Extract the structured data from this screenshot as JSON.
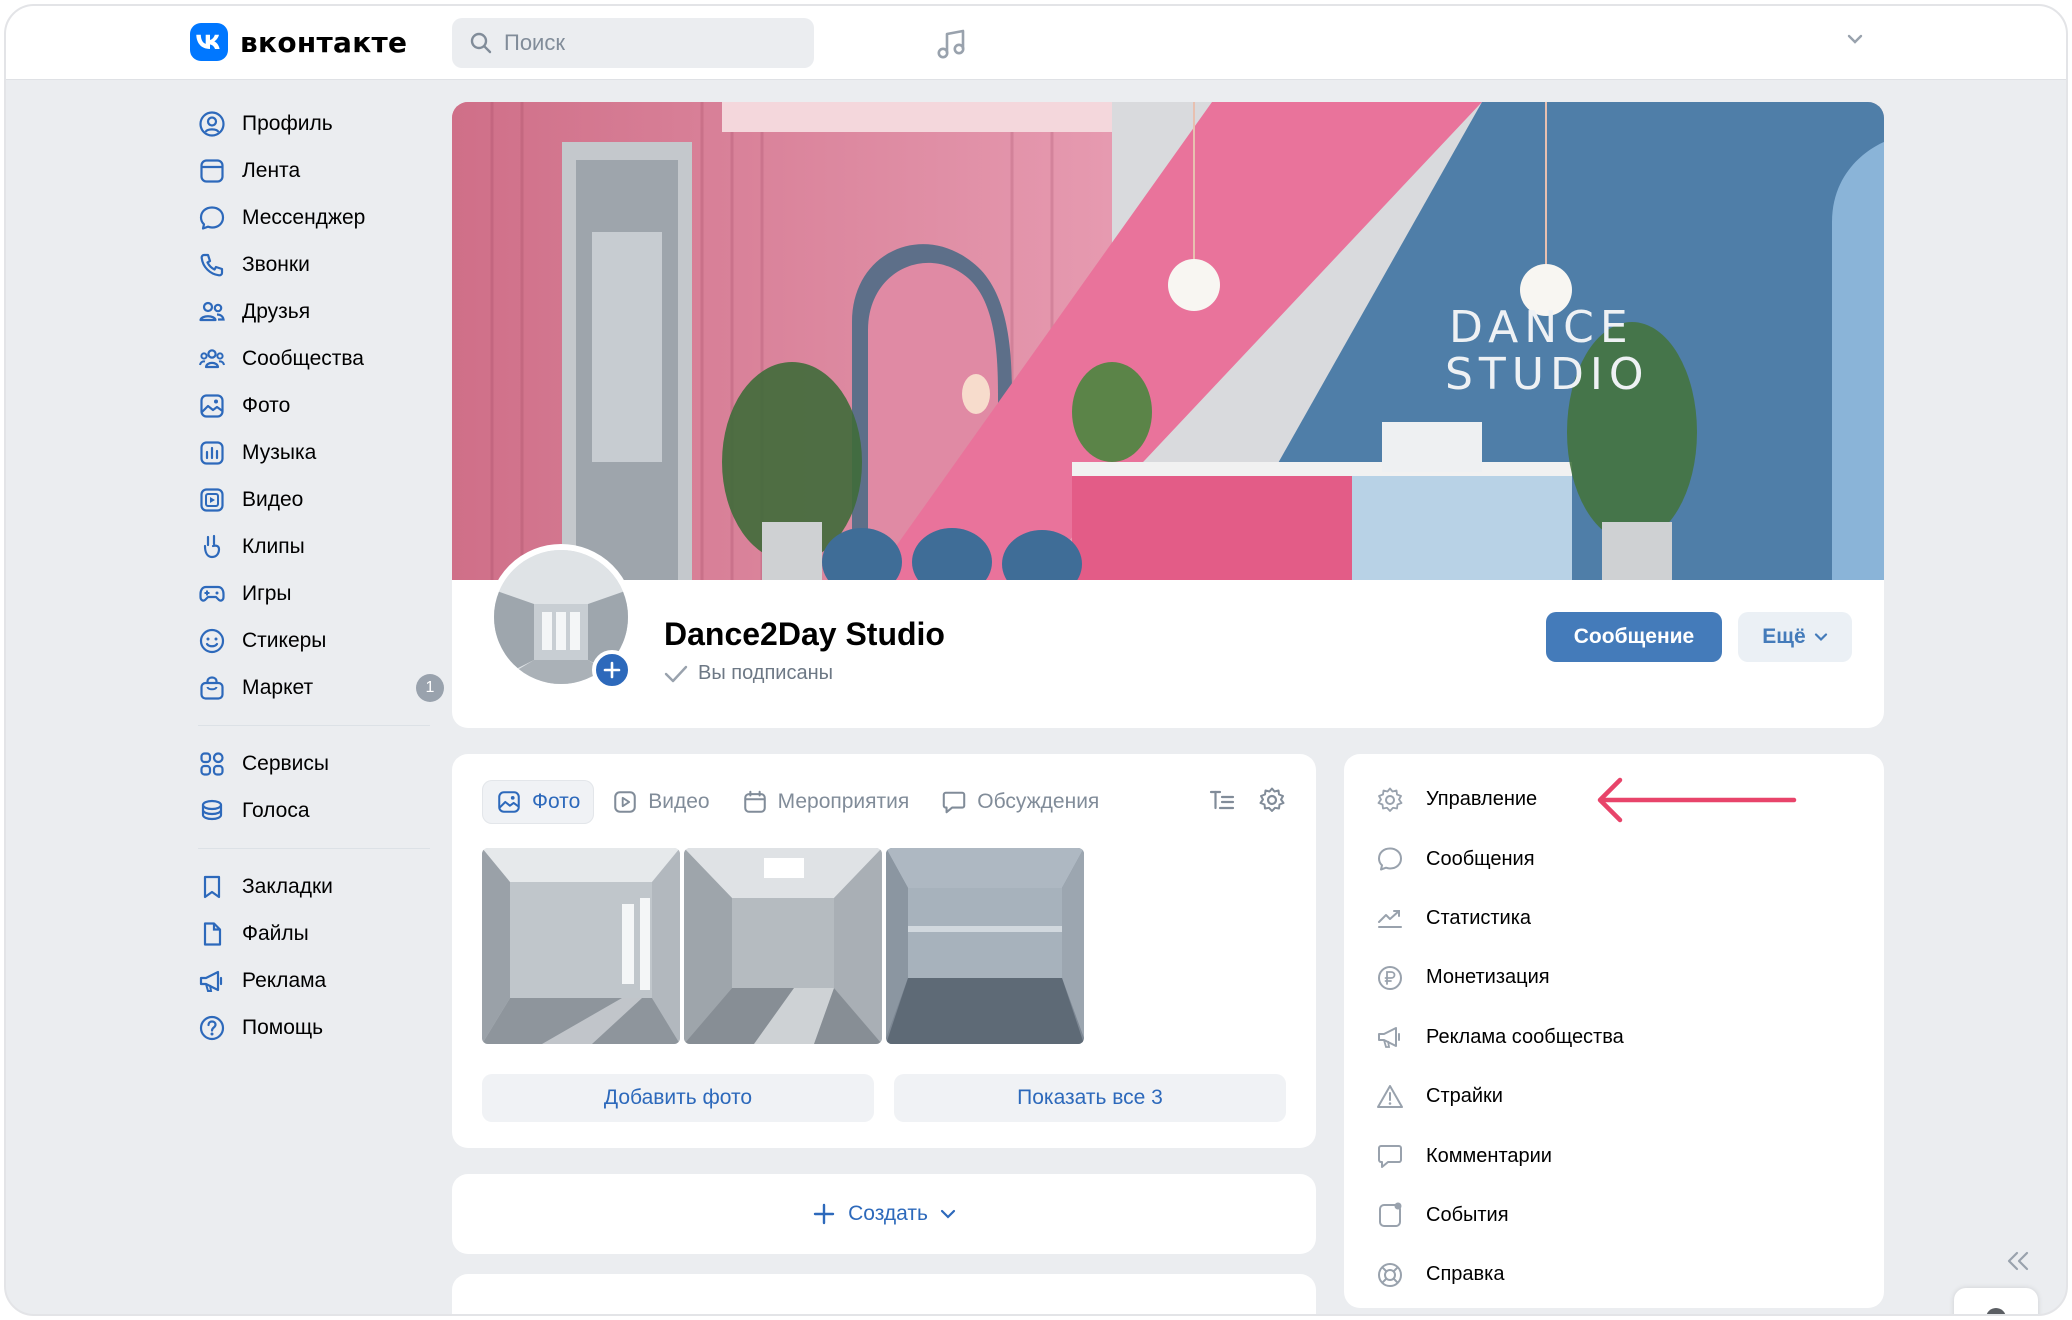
{
  "header": {
    "logo_text": "вконтакте",
    "search_placeholder": "Поиск",
    "icons": [
      "vk-logo-icon",
      "search-icon",
      "music-note-icon",
      "chevron-down-icon"
    ]
  },
  "sidebar": {
    "items": [
      {
        "label": "Профиль",
        "icon": "profile-icon"
      },
      {
        "label": "Лента",
        "icon": "feed-icon"
      },
      {
        "label": "Мессенджер",
        "icon": "messenger-icon"
      },
      {
        "label": "Звонки",
        "icon": "phone-icon"
      },
      {
        "label": "Друзья",
        "icon": "friends-icon"
      },
      {
        "label": "Сообщества",
        "icon": "communities-icon"
      },
      {
        "label": "Фото",
        "icon": "photo-icon"
      },
      {
        "label": "Музыка",
        "icon": "music-icon"
      },
      {
        "label": "Видео",
        "icon": "video-icon"
      },
      {
        "label": "Клипы",
        "icon": "clips-icon"
      },
      {
        "label": "Игры",
        "icon": "games-icon"
      },
      {
        "label": "Стикеры",
        "icon": "stickers-icon"
      },
      {
        "label": "Маркет",
        "icon": "market-icon",
        "badge": "1"
      }
    ],
    "group2": [
      {
        "label": "Сервисы",
        "icon": "services-icon"
      },
      {
        "label": "Голоса",
        "icon": "votes-icon"
      }
    ],
    "group3": [
      {
        "label": "Закладки",
        "icon": "bookmarks-icon"
      },
      {
        "label": "Файлы",
        "icon": "files-icon"
      },
      {
        "label": "Реклама",
        "icon": "ads-icon"
      },
      {
        "label": "Помощь",
        "icon": "help-icon"
      }
    ]
  },
  "group": {
    "cover_text_line1": "DANCE",
    "cover_text_line2": "STUDIO",
    "name": "Dance2Day Studio",
    "status": "Вы подписаны",
    "message_button": "Сообщение",
    "more_button": "Ещё"
  },
  "media": {
    "tabs": [
      {
        "label": "Фото",
        "active": true
      },
      {
        "label": "Видео",
        "active": false
      },
      {
        "label": "Мероприятия",
        "active": false
      },
      {
        "label": "Обсуждения",
        "active": false
      }
    ],
    "add_photo": "Добавить фото",
    "show_all": "Показать все 3"
  },
  "create": {
    "label": "Создать"
  },
  "manage": {
    "items": [
      {
        "label": "Управление",
        "icon": "gear-icon"
      },
      {
        "label": "Сообщения",
        "icon": "message-icon"
      },
      {
        "label": "Статистика",
        "icon": "stats-icon"
      },
      {
        "label": "Монетизация",
        "icon": "ruble-icon"
      },
      {
        "label": "Реклама сообщества",
        "icon": "megaphone-icon"
      },
      {
        "label": "Страйки",
        "icon": "warning-icon"
      },
      {
        "label": "Комментарии",
        "icon": "comment-icon"
      },
      {
        "label": "События",
        "icon": "events-icon"
      },
      {
        "label": "Справка",
        "icon": "help-ring-icon"
      }
    ]
  },
  "colors": {
    "accent": "#2d69bb",
    "primary_button": "#447bba",
    "annotation_arrow": "#e8446a",
    "background": "#ebedf0"
  }
}
